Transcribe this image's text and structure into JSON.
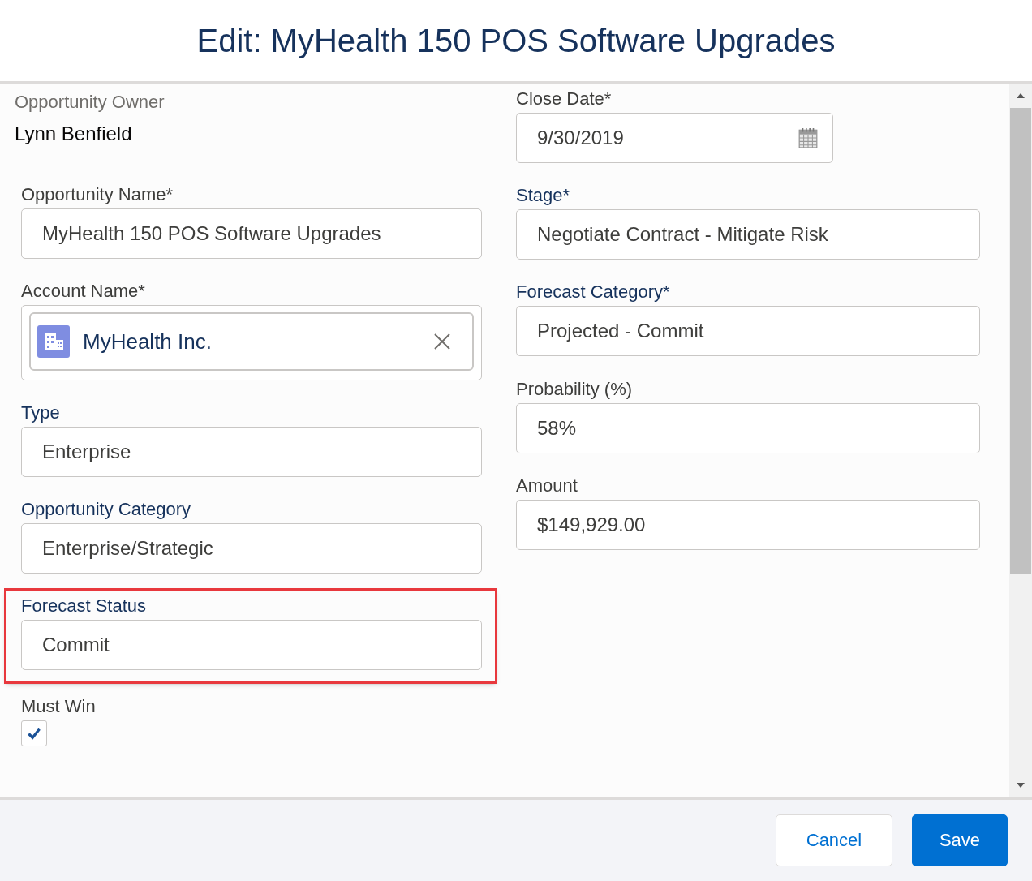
{
  "modal": {
    "title": "Edit: MyHealth 150 POS Software Upgrades"
  },
  "columns": [
    {
      "fields": [
        {
          "kind": "readonly",
          "label": "Opportunity Owner",
          "color": "#706e6b",
          "value": "Lynn Benfield",
          "highlighted": false
        },
        {
          "kind": "text",
          "label": "Opportunity Name*",
          "color": "#3e3e3c",
          "value": "MyHealth 150 POS Software Upgrades",
          "highlighted": false
        },
        {
          "kind": "lookup",
          "label": "Account Name*",
          "color": "#3e3e3c",
          "value": "MyHealth Inc.",
          "highlighted": false
        },
        {
          "kind": "text",
          "label": "Type",
          "color": "#16325c",
          "value": "Enterprise",
          "highlighted": false
        },
        {
          "kind": "text",
          "label": "Opportunity Category",
          "color": "#16325c",
          "value": "Enterprise/Strategic",
          "highlighted": false
        },
        {
          "kind": "text",
          "label": "Forecast Status",
          "color": "#16325c",
          "value": "Commit",
          "highlighted": true
        },
        {
          "kind": "checkbox",
          "label": "Must Win",
          "color": "#3e3e3c",
          "checked": true,
          "highlighted": false
        }
      ]
    },
    {
      "fields": [
        {
          "kind": "date",
          "label": "Close Date*",
          "color": "#3e3e3c",
          "value": "9/30/2019",
          "highlighted": false
        },
        {
          "kind": "text",
          "label": "Stage*",
          "color": "#16325c",
          "value": "Negotiate Contract - Mitigate Risk",
          "highlighted": false
        },
        {
          "kind": "text",
          "label": "Forecast Category*",
          "color": "#16325c",
          "value": "Projected - Commit",
          "highlighted": false
        },
        {
          "kind": "text",
          "label": "Probability (%)",
          "color": "#3e3e3c",
          "value": "58%",
          "highlighted": false
        },
        {
          "kind": "text",
          "label": "Amount",
          "color": "#3e3e3c",
          "value": "$149,929.00",
          "highlighted": false
        }
      ]
    }
  ],
  "buttons": [
    {
      "label": "Cancel",
      "kind": "neutral"
    },
    {
      "label": "Save",
      "kind": "brand"
    }
  ]
}
